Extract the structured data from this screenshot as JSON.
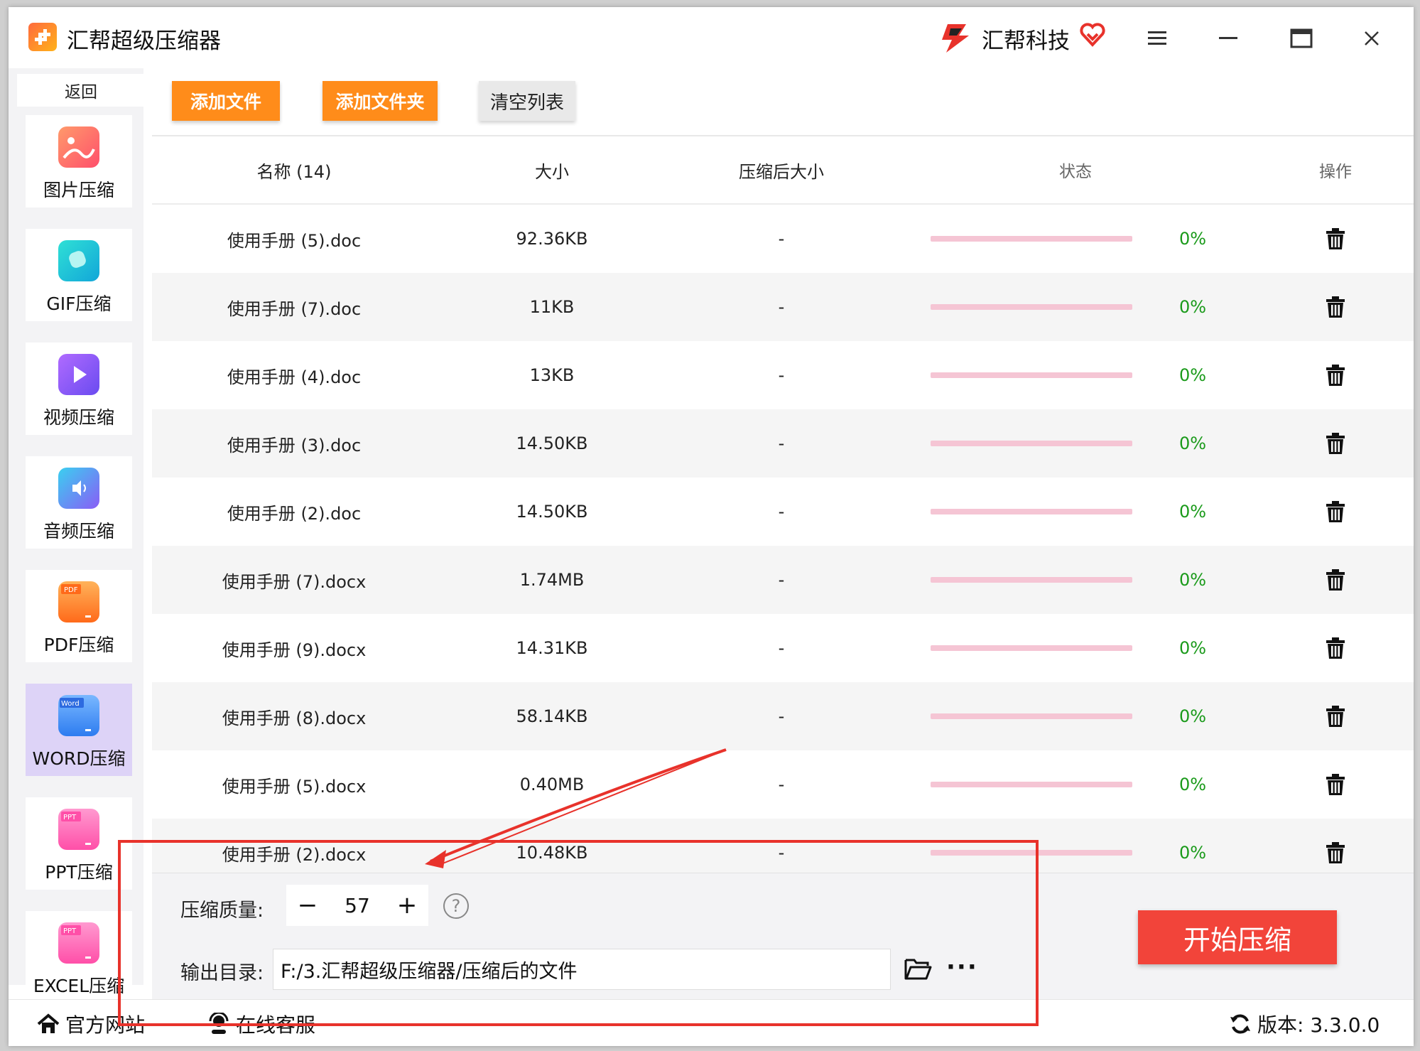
{
  "window": {
    "title": "汇帮超级压缩器",
    "brand": "汇帮科技"
  },
  "sidebar": {
    "back": "返回",
    "items": [
      {
        "label": "图片压缩",
        "icon": "image-icon",
        "color": "#ff6b6b"
      },
      {
        "label": "GIF压缩",
        "icon": "gif-icon",
        "color": "#1ec8d2"
      },
      {
        "label": "视频压缩",
        "icon": "video-icon",
        "color": "#8a5cf6"
      },
      {
        "label": "音频压缩",
        "icon": "audio-icon",
        "color": "#7b6cf6"
      },
      {
        "label": "PDF压缩",
        "icon": "pdf-icon",
        "color": "#ff8a2a"
      },
      {
        "label": "WORD压缩",
        "icon": "word-icon",
        "color": "#3d8df5",
        "active": true
      },
      {
        "label": "PPT压缩",
        "icon": "ppt-icon",
        "color": "#ff5fa8"
      },
      {
        "label": "EXCEL压缩",
        "icon": "excel-icon",
        "color": "#ff5fa8"
      }
    ]
  },
  "toolbar": {
    "add_file": "添加文件",
    "add_folder": "添加文件夹",
    "clear_list": "清空列表"
  },
  "table": {
    "headers": {
      "name": "名称 (14)",
      "size": "大小",
      "after": "压缩后大小",
      "status": "状态",
      "op": "操作"
    },
    "rows": [
      {
        "name": "使用手册 (5).doc",
        "size": "92.36KB",
        "after": "-",
        "progress": "0%"
      },
      {
        "name": "使用手册 (7).doc",
        "size": "11KB",
        "after": "-",
        "progress": "0%"
      },
      {
        "name": "使用手册 (4).doc",
        "size": "13KB",
        "after": "-",
        "progress": "0%"
      },
      {
        "name": "使用手册 (3).doc",
        "size": "14.50KB",
        "after": "-",
        "progress": "0%"
      },
      {
        "name": "使用手册 (2).doc",
        "size": "14.50KB",
        "after": "-",
        "progress": "0%"
      },
      {
        "name": "使用手册 (7).docx",
        "size": "1.74MB",
        "after": "-",
        "progress": "0%"
      },
      {
        "name": "使用手册 (9).docx",
        "size": "14.31KB",
        "after": "-",
        "progress": "0%"
      },
      {
        "name": "使用手册 (8).docx",
        "size": "58.14KB",
        "after": "-",
        "progress": "0%"
      },
      {
        "name": "使用手册 (5).docx",
        "size": "0.40MB",
        "after": "-",
        "progress": "0%"
      },
      {
        "name": "使用手册 (2).docx",
        "size": "10.48KB",
        "after": "-",
        "progress": "0%"
      }
    ]
  },
  "settings": {
    "quality_label": "压缩质量:",
    "quality_value": "57",
    "minus": "−",
    "plus": "+",
    "help": "?",
    "output_label": "输出目录:",
    "output_path": "F:/3.汇帮超级压缩器/压缩后的文件",
    "more": "···",
    "start": "开始压缩"
  },
  "statusbar": {
    "website": "官方网站",
    "support": "在线客服",
    "version": "版本: 3.3.0.0"
  },
  "colors": {
    "accent_orange": "#ff8c1a",
    "start_red": "#f2443a",
    "annotation_red": "#e8322b",
    "progress_track": "#f5c5d4",
    "percent_green": "#1a9a1a"
  }
}
